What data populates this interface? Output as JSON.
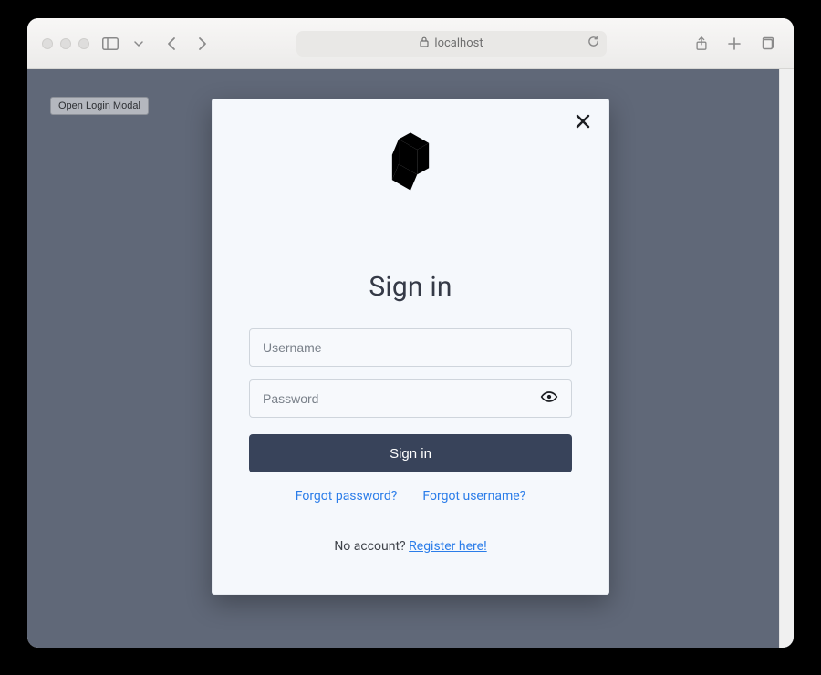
{
  "browser": {
    "address": "localhost"
  },
  "page": {
    "open_modal_btn": "Open Login Modal"
  },
  "modal": {
    "title": "Sign in",
    "username_placeholder": "Username",
    "password_placeholder": "Password",
    "submit_label": "Sign in",
    "forgot_password": "Forgot password?",
    "forgot_username": "Forgot username?",
    "no_account_text": "No account? ",
    "register_link": "Register here!"
  }
}
